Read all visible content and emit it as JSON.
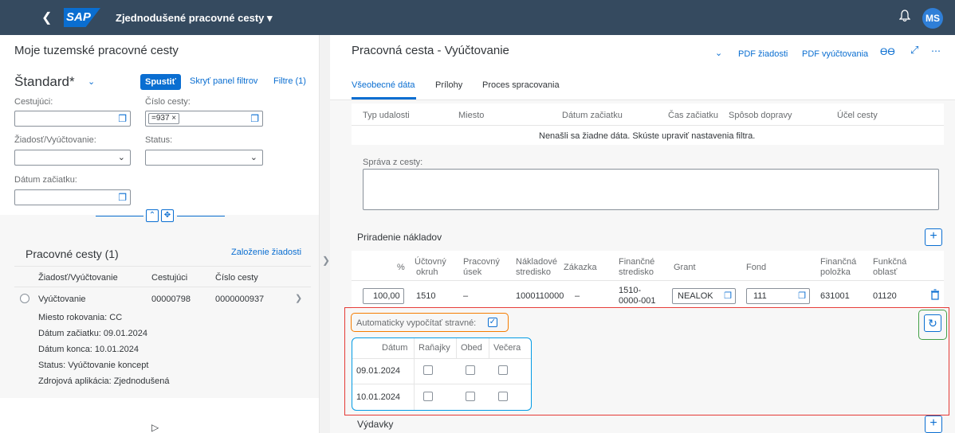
{
  "shell": {
    "title": "Zjednodušené pracovné cesty ▾",
    "logo": "SAP",
    "user_initials": "MS"
  },
  "left": {
    "title": "Moje tuzemské pracovné cesty",
    "variant": "Štandard*",
    "go_button": "Spustiť",
    "hide_filters": "Skryť panel filtrov",
    "filters": "Filtre (1)",
    "fields": {
      "traveler": "Cestujúci:",
      "trip_number": "Číslo cesty:",
      "trip_token": "=937 ×",
      "request": "Žiadosť/Vyúčtovanie:",
      "status": "Status:",
      "start_date": "Dátum začiatku:"
    },
    "list": {
      "title": "Pracovné cesty (1)",
      "create_link": "Založenie žiadosti",
      "headers": [
        "Žiadosť/Vyúčtovanie",
        "Cestujúci",
        "Číslo cesty"
      ],
      "row": {
        "type": "Vyúčtovanie",
        "traveler": "00000798",
        "trip": "0000000937"
      },
      "details": [
        "Miesto rokovania:  CC",
        "Dátum začiatku:  09.01.2024",
        "Dátum konca:  10.01.2024",
        "Status:  Vyúčtovanie koncept",
        "Zdrojová aplikácia:  Zjednodušená"
      ]
    }
  },
  "right": {
    "title": "Pracovná cesta - Vyúčtovanie",
    "pdf_request": "PDF žiadosti",
    "pdf_settlement": "PDF vyúčtovania",
    "tabs": [
      "Všeobecné dáta",
      "Prílohy",
      "Proces spracovania"
    ],
    "events_headers": [
      "Typ udalosti",
      "Miesto",
      "Dátum začiatku",
      "Čas začiatku",
      "Spôsob dopravy",
      "Účel cesty"
    ],
    "no_data": "Nenašli sa žiadne dáta. Skúste upraviť nastavenia filtra.",
    "report_label": "Správa z cesty:",
    "cost_title": "Priradenie nákladov",
    "cost_headers": {
      "pct": "%",
      "account_l1": "Účtovný",
      "account_l2": "okruh",
      "section_l1": "Pracovný",
      "section_l2": "úsek",
      "cc_l1": "Nákladové",
      "cc_l2": "stredisko",
      "order": "Zákazka",
      "fc_l1": "Finančné",
      "fc_l2": "stredisko",
      "grant": "Grant",
      "fund": "Fond",
      "fi_l1": "Finančná",
      "fi_l2": "položka",
      "func_l1": "Funkčná",
      "func_l2": "oblasť"
    },
    "cost_row": {
      "pct": "100,00",
      "account": "1510",
      "section": "–",
      "cc": "1000110000",
      "order": "–",
      "fc_l1": "1510-",
      "fc_l2": "0000-001",
      "grant": "NEALOK",
      "fund": "111",
      "fi": "631001",
      "func": "01120"
    },
    "auto_meals": "Automaticky vypočítať stravné:",
    "meals_headers": [
      "Dátum",
      "Raňajky",
      "Obed",
      "Večera"
    ],
    "meals_rows": [
      "09.01.2024",
      "10.01.2024"
    ],
    "expenses_title": "Výdavky"
  }
}
